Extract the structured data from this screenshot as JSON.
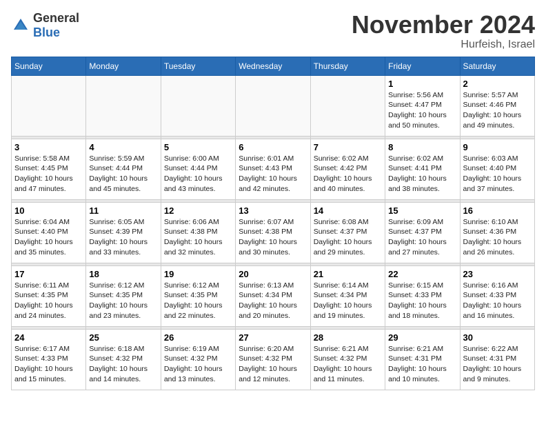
{
  "header": {
    "logo_general": "General",
    "logo_blue": "Blue",
    "month_year": "November 2024",
    "location": "Hurfeish, Israel"
  },
  "weekdays": [
    "Sunday",
    "Monday",
    "Tuesday",
    "Wednesday",
    "Thursday",
    "Friday",
    "Saturday"
  ],
  "weeks": [
    [
      {
        "day": "",
        "info": ""
      },
      {
        "day": "",
        "info": ""
      },
      {
        "day": "",
        "info": ""
      },
      {
        "day": "",
        "info": ""
      },
      {
        "day": "",
        "info": ""
      },
      {
        "day": "1",
        "info": "Sunrise: 5:56 AM\nSunset: 4:47 PM\nDaylight: 10 hours\nand 50 minutes."
      },
      {
        "day": "2",
        "info": "Sunrise: 5:57 AM\nSunset: 4:46 PM\nDaylight: 10 hours\nand 49 minutes."
      }
    ],
    [
      {
        "day": "3",
        "info": "Sunrise: 5:58 AM\nSunset: 4:45 PM\nDaylight: 10 hours\nand 47 minutes."
      },
      {
        "day": "4",
        "info": "Sunrise: 5:59 AM\nSunset: 4:44 PM\nDaylight: 10 hours\nand 45 minutes."
      },
      {
        "day": "5",
        "info": "Sunrise: 6:00 AM\nSunset: 4:44 PM\nDaylight: 10 hours\nand 43 minutes."
      },
      {
        "day": "6",
        "info": "Sunrise: 6:01 AM\nSunset: 4:43 PM\nDaylight: 10 hours\nand 42 minutes."
      },
      {
        "day": "7",
        "info": "Sunrise: 6:02 AM\nSunset: 4:42 PM\nDaylight: 10 hours\nand 40 minutes."
      },
      {
        "day": "8",
        "info": "Sunrise: 6:02 AM\nSunset: 4:41 PM\nDaylight: 10 hours\nand 38 minutes."
      },
      {
        "day": "9",
        "info": "Sunrise: 6:03 AM\nSunset: 4:40 PM\nDaylight: 10 hours\nand 37 minutes."
      }
    ],
    [
      {
        "day": "10",
        "info": "Sunrise: 6:04 AM\nSunset: 4:40 PM\nDaylight: 10 hours\nand 35 minutes."
      },
      {
        "day": "11",
        "info": "Sunrise: 6:05 AM\nSunset: 4:39 PM\nDaylight: 10 hours\nand 33 minutes."
      },
      {
        "day": "12",
        "info": "Sunrise: 6:06 AM\nSunset: 4:38 PM\nDaylight: 10 hours\nand 32 minutes."
      },
      {
        "day": "13",
        "info": "Sunrise: 6:07 AM\nSunset: 4:38 PM\nDaylight: 10 hours\nand 30 minutes."
      },
      {
        "day": "14",
        "info": "Sunrise: 6:08 AM\nSunset: 4:37 PM\nDaylight: 10 hours\nand 29 minutes."
      },
      {
        "day": "15",
        "info": "Sunrise: 6:09 AM\nSunset: 4:37 PM\nDaylight: 10 hours\nand 27 minutes."
      },
      {
        "day": "16",
        "info": "Sunrise: 6:10 AM\nSunset: 4:36 PM\nDaylight: 10 hours\nand 26 minutes."
      }
    ],
    [
      {
        "day": "17",
        "info": "Sunrise: 6:11 AM\nSunset: 4:35 PM\nDaylight: 10 hours\nand 24 minutes."
      },
      {
        "day": "18",
        "info": "Sunrise: 6:12 AM\nSunset: 4:35 PM\nDaylight: 10 hours\nand 23 minutes."
      },
      {
        "day": "19",
        "info": "Sunrise: 6:12 AM\nSunset: 4:35 PM\nDaylight: 10 hours\nand 22 minutes."
      },
      {
        "day": "20",
        "info": "Sunrise: 6:13 AM\nSunset: 4:34 PM\nDaylight: 10 hours\nand 20 minutes."
      },
      {
        "day": "21",
        "info": "Sunrise: 6:14 AM\nSunset: 4:34 PM\nDaylight: 10 hours\nand 19 minutes."
      },
      {
        "day": "22",
        "info": "Sunrise: 6:15 AM\nSunset: 4:33 PM\nDaylight: 10 hours\nand 18 minutes."
      },
      {
        "day": "23",
        "info": "Sunrise: 6:16 AM\nSunset: 4:33 PM\nDaylight: 10 hours\nand 16 minutes."
      }
    ],
    [
      {
        "day": "24",
        "info": "Sunrise: 6:17 AM\nSunset: 4:33 PM\nDaylight: 10 hours\nand 15 minutes."
      },
      {
        "day": "25",
        "info": "Sunrise: 6:18 AM\nSunset: 4:32 PM\nDaylight: 10 hours\nand 14 minutes."
      },
      {
        "day": "26",
        "info": "Sunrise: 6:19 AM\nSunset: 4:32 PM\nDaylight: 10 hours\nand 13 minutes."
      },
      {
        "day": "27",
        "info": "Sunrise: 6:20 AM\nSunset: 4:32 PM\nDaylight: 10 hours\nand 12 minutes."
      },
      {
        "day": "28",
        "info": "Sunrise: 6:21 AM\nSunset: 4:32 PM\nDaylight: 10 hours\nand 11 minutes."
      },
      {
        "day": "29",
        "info": "Sunrise: 6:21 AM\nSunset: 4:31 PM\nDaylight: 10 hours\nand 10 minutes."
      },
      {
        "day": "30",
        "info": "Sunrise: 6:22 AM\nSunset: 4:31 PM\nDaylight: 10 hours\nand 9 minutes."
      }
    ]
  ]
}
